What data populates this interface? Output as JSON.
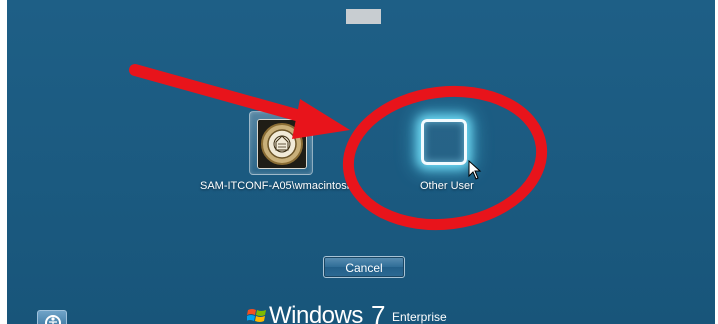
{
  "users": [
    {
      "label": "SAM-ITCONF-A05\\wmacintosh",
      "icon": "user-photo-seal"
    },
    {
      "label": "Other User",
      "icon": "blank-user-frame"
    }
  ],
  "cancel_label": "Cancel",
  "branding": {
    "name": "Windows",
    "version": "7",
    "edition": "Enterprise"
  },
  "annotation": {
    "color": "#e8141b",
    "shape": "arrow-and-ellipse"
  },
  "colors": {
    "background": "#1b5a80",
    "glow": "#78e6ff"
  }
}
